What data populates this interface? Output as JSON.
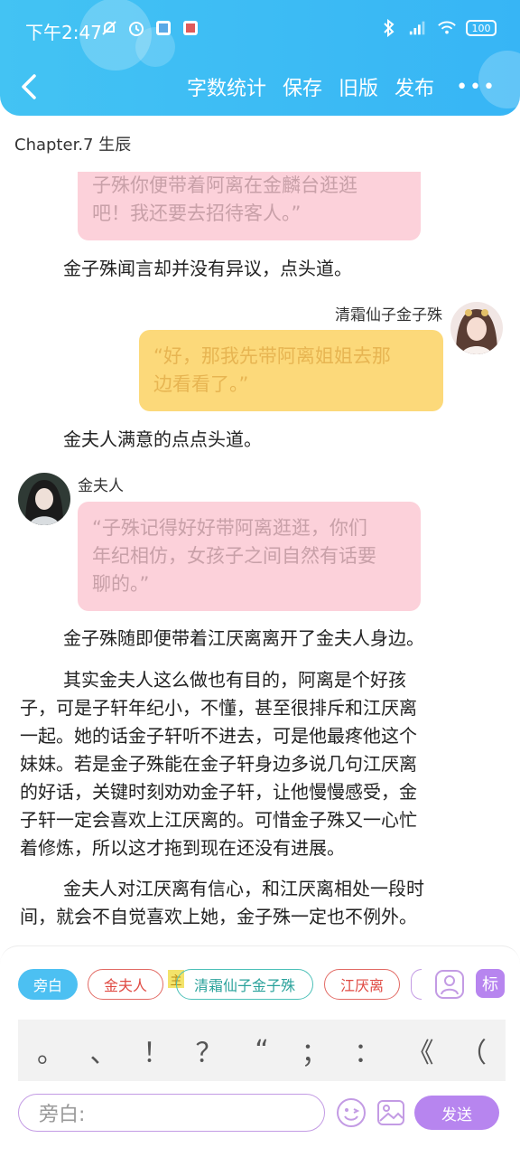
{
  "status_bar": {
    "time": "下午2:47",
    "battery": "100"
  },
  "toolbar": {
    "word_count": "字数统计",
    "save": "保存",
    "old_version": "旧版",
    "publish": "发布",
    "more": "•••"
  },
  "chapter_title": "Chapter.7 生辰",
  "messages": [
    {
      "type": "bubble",
      "text_lines": [
        "子殊你便带着阿离在金麟台逛逛",
        "吧！我还要去招待客人。”"
      ]
    },
    {
      "type": "narration",
      "text": "金子殊闻言却并没有异议，点头道。"
    },
    {
      "type": "speaker",
      "name": "清霜仙子金子殊",
      "text_lines": [
        "“好，那我先带阿离姐姐去那",
        "边看看了。”"
      ]
    },
    {
      "type": "narration",
      "text": "金夫人满意的点点头道。"
    },
    {
      "type": "speaker",
      "name": "金夫人",
      "text_lines": [
        "“子殊记得好好带阿离逛逛，你们",
        "年纪相仿，女孩子之间自然有话要",
        "聊的。”"
      ]
    },
    {
      "type": "narration",
      "text": "金子殊随即便带着江厌离离开了金夫人身边。"
    },
    {
      "type": "paragraph",
      "lines": [
        "其实金夫人这么做也有目的，阿离是个好孩",
        "子，可是子轩年纪小，不懂，甚至很排斥和江厌离",
        "一起。她的话金子轩听不进去，可是他最疼他这个",
        "妹妹。若是金子殊能在金子轩身边多说几句江厌离",
        "的好话，关键时刻劝劝金子轩，让他慢慢感受，金",
        "子轩一定会喜欢上江厌离的。可惜金子殊又一心忙",
        "着修炼，所以这才拖到现在还没有进展。"
      ]
    },
    {
      "type": "paragraph",
      "lines": [
        "金夫人对江厌离有信心，和江厌离相处一段时",
        "间，就会不自觉喜欢上她，金子殊一定也不例外。"
      ]
    }
  ],
  "roles": [
    {
      "label": "旁白",
      "selected": true
    },
    {
      "label": "金夫人"
    },
    {
      "label": "清霜仙子金子殊",
      "badge": "主"
    },
    {
      "label": "江厌离"
    }
  ],
  "role_tools": {
    "mark": "标"
  },
  "punctuation": [
    "。",
    "、",
    "！",
    "？",
    "“",
    "；",
    "：",
    "《",
    "（"
  ],
  "input": {
    "placeholder": "旁白:"
  },
  "send": "发送",
  "colors": {
    "header": "#3fbef4",
    "pink_bubble": "#fcd1da",
    "yellow_bubble": "#fcd97a",
    "accent": "#b785ef"
  }
}
